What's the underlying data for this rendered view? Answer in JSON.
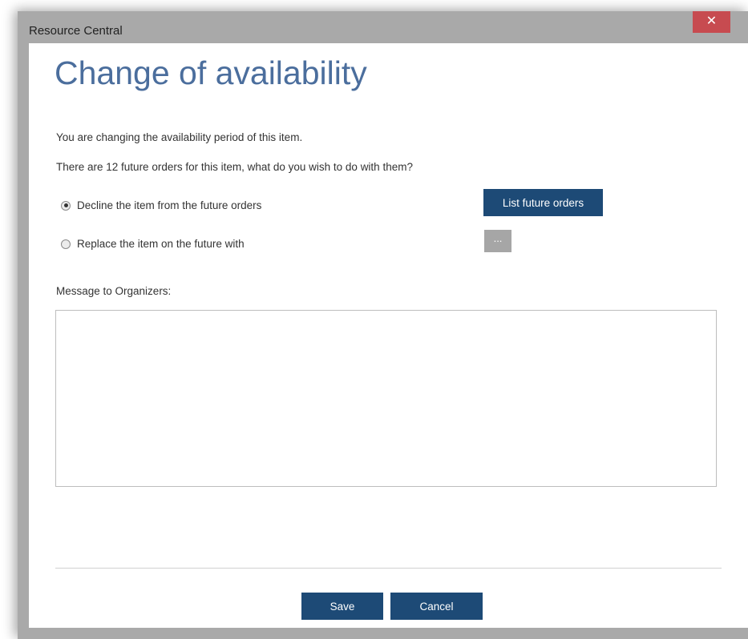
{
  "window": {
    "title": "Resource Central",
    "close_label": "✕"
  },
  "dialog": {
    "heading": "Change of availability",
    "intro": "You are changing the availability period of this item.",
    "question": "There are 12 future orders for this item, what do you wish to do with them?",
    "options": [
      {
        "label": "Decline the item from the future orders",
        "selected": true
      },
      {
        "label": "Replace the item on the future with",
        "selected": false
      }
    ],
    "list_orders_label": "List future orders",
    "browse_label": "...",
    "message_label": "Message to Organizers:",
    "message_value": "",
    "save_label": "Save",
    "cancel_label": "Cancel"
  },
  "colors": {
    "accent": "#1d4a76",
    "title": "#4b6e9d",
    "close": "#c74b50"
  }
}
